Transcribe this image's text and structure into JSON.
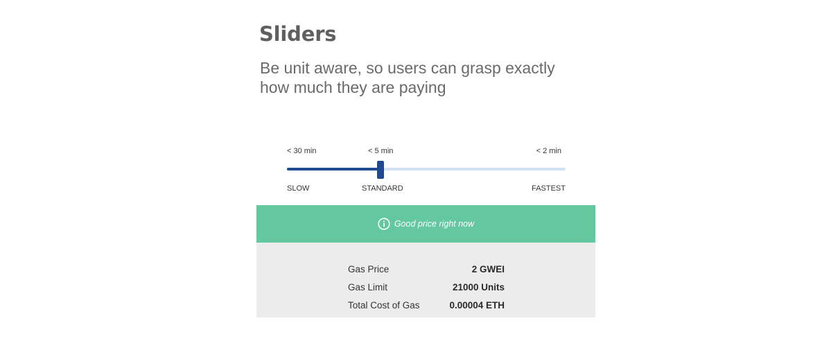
{
  "header": {
    "title": "Sliders",
    "subtitle": "Be unit aware, so users can grasp exactly how much they are paying"
  },
  "slider": {
    "time_labels": [
      "< 30 min",
      "< 5 min",
      "< 2 min"
    ],
    "speed_labels": [
      "SLOW",
      "STANDARD",
      "FASTEST"
    ],
    "selected_position": 0.335,
    "colors": {
      "filled": "#1f4a8f",
      "unfilled": "#d3e2f3"
    }
  },
  "banner": {
    "icon": "info-icon",
    "text": "Good price right now",
    "color": "#63c8a0"
  },
  "gas_details": {
    "rows": [
      {
        "label": "Gas Price",
        "value": "2 GWEI"
      },
      {
        "label": "Gas Limit",
        "value": "21000 Units"
      },
      {
        "label": "Total Cost of Gas",
        "value": "0.00004 ETH"
      }
    ]
  }
}
